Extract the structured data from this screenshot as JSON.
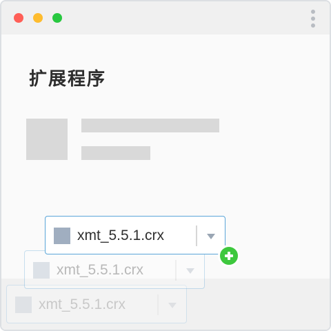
{
  "window": {
    "controls": {
      "close_color": "#ff5f57",
      "minimize_color": "#febc2e",
      "maximize_color": "#28c840"
    },
    "menu_icon": "more-vertical-icon"
  },
  "page": {
    "title": "扩展程序"
  },
  "drag": {
    "file_name": "xmt_5.5.1.crx",
    "file_icon": "file-icon",
    "action_icon": "add-plus-icon",
    "accent_color": "#3ec83e",
    "border_color": "#5aa5d8"
  }
}
